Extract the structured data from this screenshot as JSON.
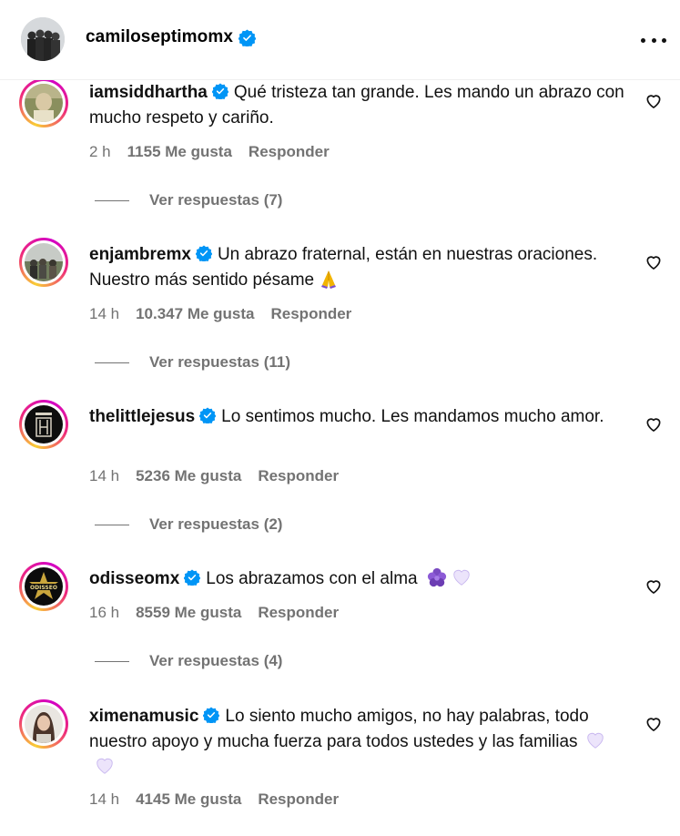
{
  "post_author": {
    "username": "camiloseptimomx",
    "verified": true
  },
  "comments": [
    {
      "username": "iamsiddhartha",
      "text": "Qué tristeza tan grande. Les mando un abrazo con mucho respeto y cariño.",
      "time": "2 h",
      "likes": "1155 Me gusta",
      "reply_label": "Responder",
      "view_replies": "Ver respuestas (7)"
    },
    {
      "username": "enjambremx",
      "text": "Un abrazo fraternal, están en nuestras oraciones. Nuestro más sentido pésame",
      "emoji": "praying-hands",
      "time": "14 h",
      "likes": "10.347 Me gusta",
      "reply_label": "Responder",
      "view_replies": "Ver respuestas (11)"
    },
    {
      "username": "thelittlejesus",
      "text": "Lo sentimos mucho. Les mandamos mucho amor.",
      "time": "14 h",
      "likes": "5236 Me gusta",
      "reply_label": "Responder",
      "view_replies": "Ver respuestas (2)"
    },
    {
      "username": "odisseomx",
      "text": "Los abrazamos con el alma",
      "emoji": "purple-flower white-heart",
      "time": "16 h",
      "likes": "8559 Me gusta",
      "reply_label": "Responder",
      "view_replies": "Ver respuestas (4)"
    },
    {
      "username": "ximenamusic",
      "text": "Lo siento mucho amigos, no hay palabras, todo nuestro apoyo y mucha fuerza para todos ustedes y las familias",
      "emoji": "white-heart white-heart",
      "time": "14 h",
      "likes": "4145 Me gusta",
      "reply_label": "Responder"
    }
  ],
  "colors": {
    "verified": "#0095f6",
    "meta_gray": "#737373",
    "story_ring": [
      "#f9ce34",
      "#ee2a7b",
      "#d300c5"
    ]
  }
}
